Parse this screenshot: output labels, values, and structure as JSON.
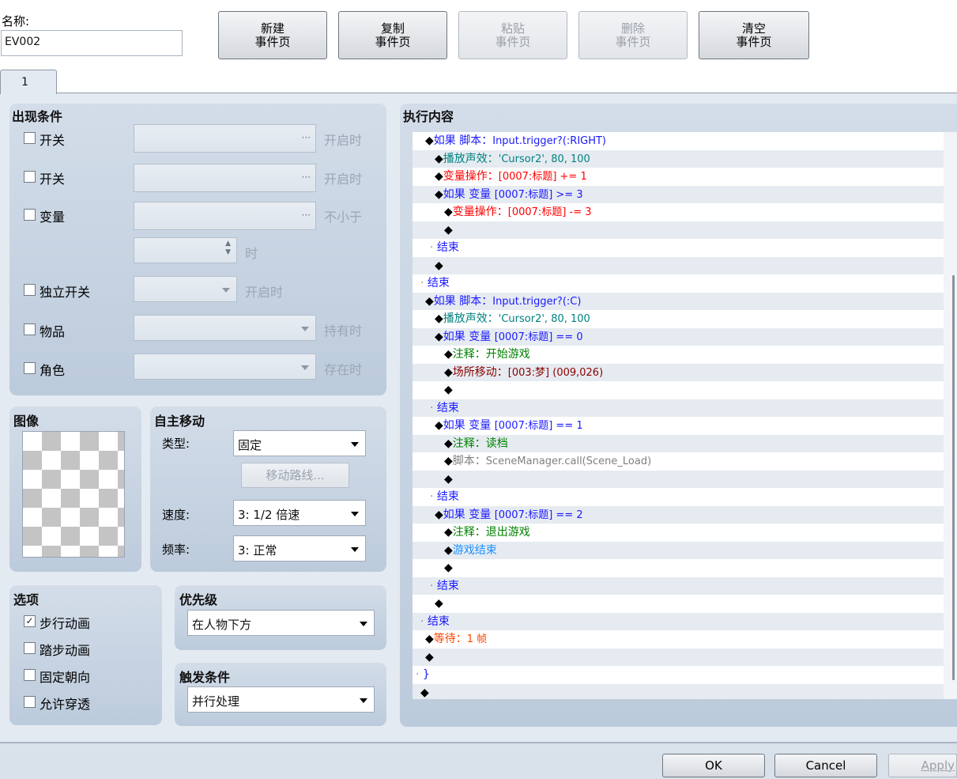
{
  "name": {
    "label": "名称:",
    "value": "EV002"
  },
  "top_buttons": {
    "new": [
      "新建",
      "事件页"
    ],
    "copy": [
      "复制",
      "事件页"
    ],
    "paste": [
      "粘贴",
      "事件页"
    ],
    "delete": [
      "删除",
      "事件页"
    ],
    "clear": [
      "清空",
      "事件页"
    ]
  },
  "tab": "1",
  "conditions": {
    "title": "出现条件",
    "rows": [
      {
        "label": "开关",
        "suffix": "开启时"
      },
      {
        "label": "开关",
        "suffix": "开启时"
      },
      {
        "label": "变量",
        "suffix": "不小于"
      },
      {
        "label": "",
        "suffix": "时"
      },
      {
        "label": "独立开关",
        "suffix": "开启时"
      },
      {
        "label": "物品",
        "suffix": "持有时"
      },
      {
        "label": "角色",
        "suffix": "存在时"
      }
    ]
  },
  "image": {
    "title": "图像"
  },
  "autonomous": {
    "title": "自主移动",
    "type_label": "类型:",
    "type_value": "固定",
    "route_button": "移动路线...",
    "speed_label": "速度:",
    "speed_value": "3: 1/2 倍速",
    "freq_label": "频率:",
    "freq_value": "3: 正常"
  },
  "options": {
    "title": "选项",
    "items": [
      {
        "label": "步行动画",
        "checked": true
      },
      {
        "label": "踏步动画",
        "checked": false
      },
      {
        "label": "固定朝向",
        "checked": false
      },
      {
        "label": "允许穿透",
        "checked": false
      }
    ]
  },
  "priority": {
    "title": "优先级",
    "value": "在人物下方"
  },
  "trigger": {
    "title": "触发条件",
    "value": "并行处理"
  },
  "contents": {
    "title": "执行内容",
    "lines": [
      {
        "indent": 1,
        "prefix": "◆",
        "parts": [
          {
            "t": "如果 脚本：",
            "c": "#1a1aff"
          },
          {
            "t": "Input.trigger?(:RIGHT)",
            "c": "#1a1aff",
            "s": 1
          }
        ]
      },
      {
        "indent": 2,
        "prefix": "◆",
        "parts": [
          {
            "t": "播放声效：",
            "c": "#008080"
          },
          {
            "t": "'Cursor2', 80, 100",
            "c": "#008080",
            "s": 1
          }
        ]
      },
      {
        "indent": 2,
        "prefix": "◆",
        "parts": [
          {
            "t": "变量操作：",
            "c": "#ff0000"
          },
          {
            "t": "[0007:标题] += 1",
            "c": "#ff0000",
            "s": 1
          }
        ]
      },
      {
        "indent": 2,
        "prefix": "◆",
        "parts": [
          {
            "t": "如果 变量 ",
            "c": "#1a1aff"
          },
          {
            "t": "[0007:标题] >= 3",
            "c": "#1a1aff",
            "s": 1
          }
        ]
      },
      {
        "indent": 3,
        "prefix": "◆",
        "parts": [
          {
            "t": "变量操作：",
            "c": "#ff0000"
          },
          {
            "t": "[0007:标题] -= 3",
            "c": "#ff0000",
            "s": 1
          }
        ]
      },
      {
        "indent": 3,
        "prefix": "◆",
        "parts": []
      },
      {
        "indent": 1.5,
        "prefix": "· ",
        "parts": [
          {
            "t": "结束",
            "c": "#1a1aff"
          }
        ]
      },
      {
        "indent": 2,
        "prefix": "◆",
        "parts": []
      },
      {
        "indent": 0.5,
        "prefix": "· ",
        "parts": [
          {
            "t": "结束",
            "c": "#1a1aff"
          }
        ]
      },
      {
        "indent": 1,
        "prefix": "◆",
        "parts": [
          {
            "t": "如果 脚本：",
            "c": "#1a1aff"
          },
          {
            "t": "Input.trigger?(:C)",
            "c": "#1a1aff",
            "s": 1
          }
        ]
      },
      {
        "indent": 2,
        "prefix": "◆",
        "parts": [
          {
            "t": "播放声效：",
            "c": "#008080"
          },
          {
            "t": "'Cursor2', 80, 100",
            "c": "#008080",
            "s": 1
          }
        ]
      },
      {
        "indent": 2,
        "prefix": "◆",
        "parts": [
          {
            "t": "如果 变量 ",
            "c": "#1a1aff"
          },
          {
            "t": "[0007:标题] == 0",
            "c": "#1a1aff",
            "s": 1
          }
        ]
      },
      {
        "indent": 3,
        "prefix": "◆",
        "parts": [
          {
            "t": "注释：开始游戏",
            "c": "#008000"
          }
        ]
      },
      {
        "indent": 3,
        "prefix": "◆",
        "parts": [
          {
            "t": "场所移动：",
            "c": "#8b0000"
          },
          {
            "t": "[003:梦] (009,026)",
            "c": "#8b0000",
            "s": 1
          }
        ]
      },
      {
        "indent": 3,
        "prefix": "◆",
        "parts": []
      },
      {
        "indent": 1.5,
        "prefix": "· ",
        "parts": [
          {
            "t": "结束",
            "c": "#1a1aff"
          }
        ]
      },
      {
        "indent": 2,
        "prefix": "◆",
        "parts": [
          {
            "t": "如果 变量 ",
            "c": "#1a1aff"
          },
          {
            "t": "[0007:标题] == 1",
            "c": "#1a1aff",
            "s": 1
          }
        ]
      },
      {
        "indent": 3,
        "prefix": "◆",
        "parts": [
          {
            "t": "注释：读档",
            "c": "#008000"
          }
        ]
      },
      {
        "indent": 3,
        "prefix": "◆",
        "parts": [
          {
            "t": "脚本：",
            "c": "#808080"
          },
          {
            "t": "SceneManager.call(Scene_Load)",
            "c": "#808080",
            "s": 1
          }
        ]
      },
      {
        "indent": 3,
        "prefix": "◆",
        "parts": []
      },
      {
        "indent": 1.5,
        "prefix": "· ",
        "parts": [
          {
            "t": "结束",
            "c": "#1a1aff"
          }
        ]
      },
      {
        "indent": 2,
        "prefix": "◆",
        "parts": [
          {
            "t": "如果 变量 ",
            "c": "#1a1aff"
          },
          {
            "t": "[0007:标题] == 2",
            "c": "#1a1aff",
            "s": 1
          }
        ]
      },
      {
        "indent": 3,
        "prefix": "◆",
        "parts": [
          {
            "t": "注释：退出游戏",
            "c": "#008000"
          }
        ]
      },
      {
        "indent": 3,
        "prefix": "◆",
        "parts": [
          {
            "t": "游戏结束",
            "c": "#1e90ff"
          }
        ]
      },
      {
        "indent": 3,
        "prefix": "◆",
        "parts": []
      },
      {
        "indent": 1.5,
        "prefix": "· ",
        "parts": [
          {
            "t": "结束",
            "c": "#1a1aff"
          }
        ]
      },
      {
        "indent": 2,
        "prefix": "◆",
        "parts": []
      },
      {
        "indent": 0.5,
        "prefix": "· ",
        "parts": [
          {
            "t": "结束",
            "c": "#1a1aff"
          }
        ]
      },
      {
        "indent": 1,
        "prefix": "◆",
        "parts": [
          {
            "t": "等待：",
            "c": "#ff4500"
          },
          {
            "t": "1 帧",
            "c": "#ff4500",
            "s": 1
          }
        ]
      },
      {
        "indent": 1,
        "prefix": "◆",
        "parts": []
      },
      {
        "indent": 0,
        "prefix": "· ",
        "parts": [
          {
            "t": "}",
            "c": "#1a1aff"
          }
        ]
      },
      {
        "indent": 0.5,
        "prefix": "◆",
        "parts": []
      }
    ]
  },
  "footer": {
    "ok": "OK",
    "cancel": "Cancel",
    "apply": "Apply"
  }
}
